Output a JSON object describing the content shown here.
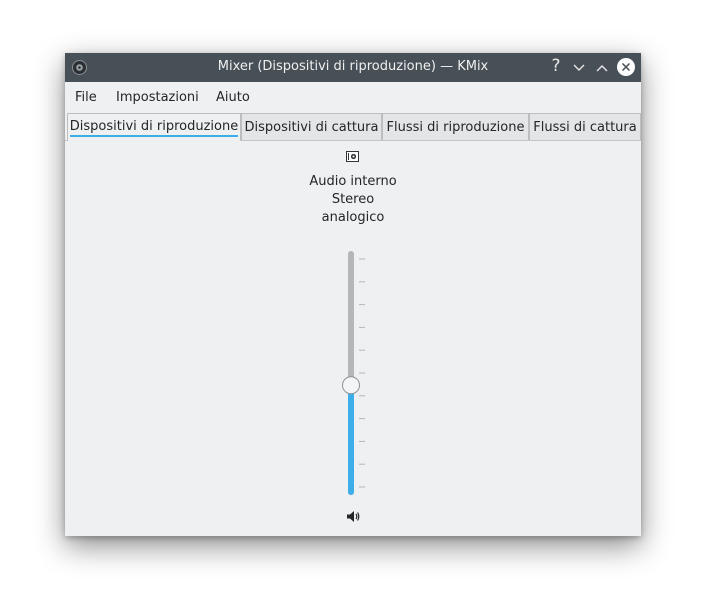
{
  "window": {
    "title": "Mixer (Dispositivi di riproduzione) — KMix",
    "app_icon": "kmix-app-icon",
    "buttons": {
      "help_glyph": "?",
      "minimize_glyph": "⌄",
      "maximize_glyph": "⌃",
      "close_glyph": "✕"
    }
  },
  "menubar": {
    "items": [
      {
        "label": "File"
      },
      {
        "label": "Impostazioni"
      },
      {
        "label": "Aiuto"
      }
    ]
  },
  "tabs": [
    {
      "label": "Dispositivi di riproduzione",
      "active": true
    },
    {
      "label": "Dispositivi di cattura",
      "active": false
    },
    {
      "label": "Flussi di riproduzione",
      "active": false
    },
    {
      "label": "Flussi di cattura",
      "active": false
    }
  ],
  "device": {
    "icon": "audio-card-icon",
    "label_lines": [
      "Audio interno",
      "Stereo",
      "analogico"
    ],
    "volume_fraction": 0.45,
    "mute_icon": "speaker-icon"
  },
  "colors": {
    "accent": "#3daee9",
    "titlebar": "#475057",
    "window_bg": "#eff0f1"
  }
}
